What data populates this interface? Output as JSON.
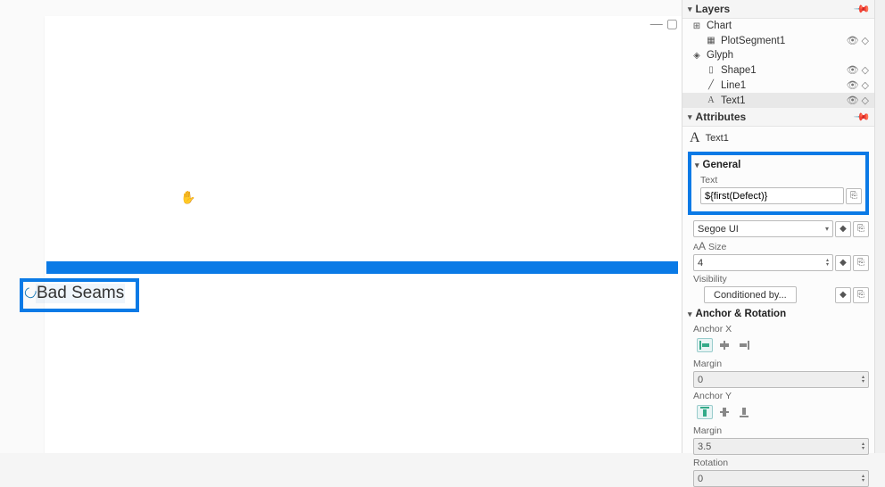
{
  "panels": {
    "layers": {
      "title": "Layers",
      "items": [
        {
          "label": "Chart",
          "icon": "chart"
        },
        {
          "label": "PlotSegment1",
          "icon": "plotseg",
          "indent": 1,
          "actions": true
        },
        {
          "label": "Glyph",
          "icon": "glyph"
        },
        {
          "label": "Shape1",
          "icon": "shape",
          "indent": 1,
          "actions": true
        },
        {
          "label": "Line1",
          "icon": "line",
          "indent": 1,
          "actions": true
        },
        {
          "label": "Text1",
          "icon": "text",
          "indent": 1,
          "actions": true,
          "selected": true
        }
      ]
    },
    "attributes": {
      "title": "Attributes",
      "selected_icon": "A",
      "selected_label": "Text1",
      "general": {
        "title": "General",
        "text_label": "Text",
        "text_value": "${first(Defect)}",
        "font_value": "Segoe UI",
        "size_label": "Size",
        "size_value": "4",
        "visibility_label": "Visibility",
        "visibility_button": "Conditioned by..."
      },
      "anchor": {
        "title": "Anchor & Rotation",
        "anchor_x_label": "Anchor X",
        "margin_x_label": "Margin",
        "margin_x_value": "0",
        "anchor_y_label": "Anchor Y",
        "margin_y_label": "Margin",
        "margin_y_value": "3.5",
        "rotation_label": "Rotation",
        "rotation_value": "0"
      }
    }
  },
  "canvas": {
    "text_sample": "Bad Seams"
  }
}
